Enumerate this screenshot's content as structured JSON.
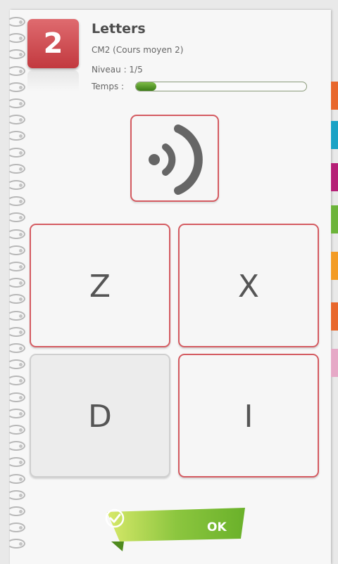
{
  "header": {
    "level_number": "2",
    "title": "Letters",
    "class_name": "CM2 (Cours moyen 2)",
    "level_text": "Niveau : 1/5",
    "timer_label": "Temps :",
    "timer_progress": 0.12
  },
  "sound_button": {
    "icon": "speaker-icon"
  },
  "answers": [
    "Z",
    "X",
    "D",
    "I"
  ],
  "answer_disabled": [
    false,
    false,
    true,
    false
  ],
  "ok_button": {
    "label": "OK",
    "icon": "check-icon"
  },
  "colors": {
    "accent_red": "#d45b61",
    "badge_red": "#c2393f",
    "ok_green": "#8cc63f",
    "side_tabs": [
      "#e8672c",
      "#1aa2c5",
      "#b51f76",
      "#6cb43a",
      "#f39c26",
      "#e8672c",
      "#e6a9c7"
    ]
  }
}
